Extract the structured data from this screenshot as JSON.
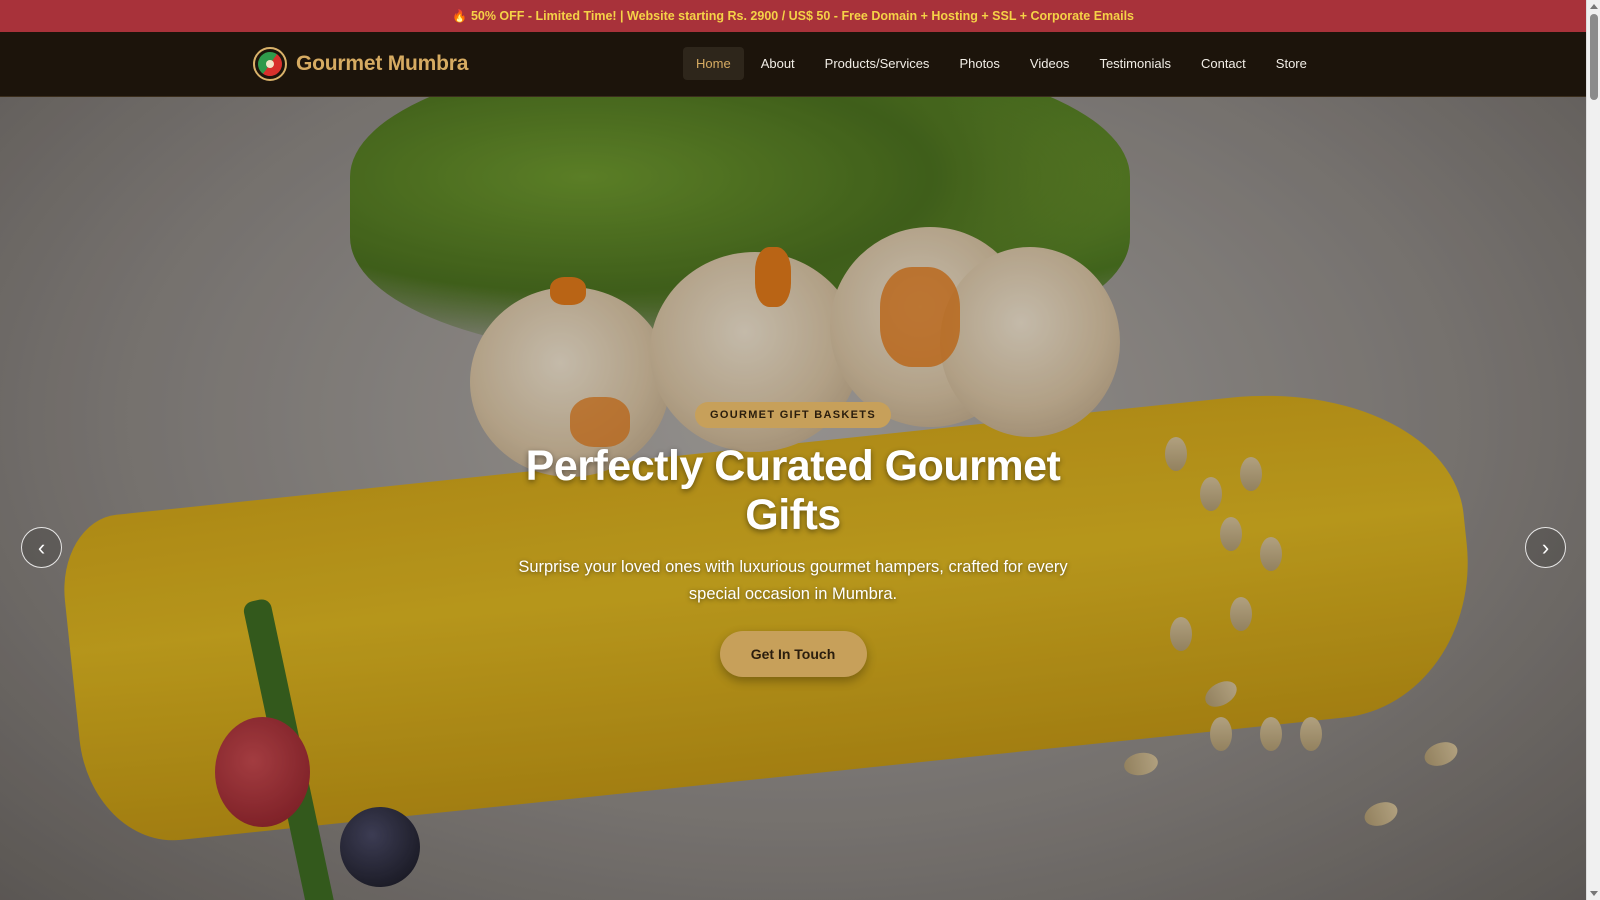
{
  "promo": {
    "icon": "flame-icon",
    "text": "50% OFF - Limited Time! | Website starting Rs. 2900 / US$ 50 - Free Domain + Hosting + SSL + Corporate Emails"
  },
  "brand": {
    "name": "Gourmet Mumbra",
    "logo": "yin-yang-logo"
  },
  "nav": {
    "items": [
      {
        "label": "Home",
        "active": true
      },
      {
        "label": "About"
      },
      {
        "label": "Products/Services"
      },
      {
        "label": "Photos"
      },
      {
        "label": "Videos"
      },
      {
        "label": "Testimonials"
      },
      {
        "label": "Contact"
      },
      {
        "label": "Store"
      }
    ]
  },
  "hero": {
    "badge": "GOURMET GIFT BASKETS",
    "title": "Perfectly Curated Gourmet Gifts",
    "subtitle": "Surprise your loved ones with luxurious gourmet hampers, crafted for every special occasion in Mumbra.",
    "cta": "Get In Touch",
    "prev_icon": "‹",
    "next_icon": "›"
  },
  "colors": {
    "promo_bg": "#a8323a",
    "promo_text": "#f5d247",
    "nav_bg": "#1c140b",
    "accent": "#c7a05a",
    "brand_text": "#d6ab62"
  }
}
